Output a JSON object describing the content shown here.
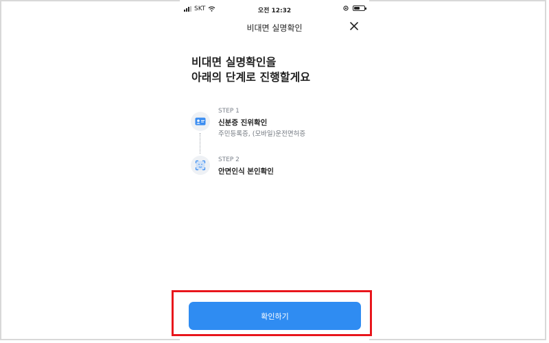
{
  "status_bar": {
    "carrier": "SKT",
    "time": "오전 12:32"
  },
  "nav": {
    "title": "비대면 실명확인",
    "close_icon": "close-icon"
  },
  "heading": {
    "line1": "비대면 실명확인을",
    "line2": "아래의 단계로 진행할게요"
  },
  "steps": [
    {
      "label": "STEP 1",
      "title": "신분증 진위확인",
      "description": "주민등록증, (모바일)운전면허증",
      "icon": "id-card-icon"
    },
    {
      "label": "STEP 2",
      "title": "안면인식 본인확인",
      "icon": "face-scan-icon"
    }
  ],
  "confirm_button": {
    "label": "확인하기"
  },
  "colors": {
    "primary": "#2f8cf2",
    "highlight_border": "#e8151b",
    "icon_bg": "#eef1f5",
    "text_dark": "#222222",
    "text_muted": "#6f757d"
  }
}
